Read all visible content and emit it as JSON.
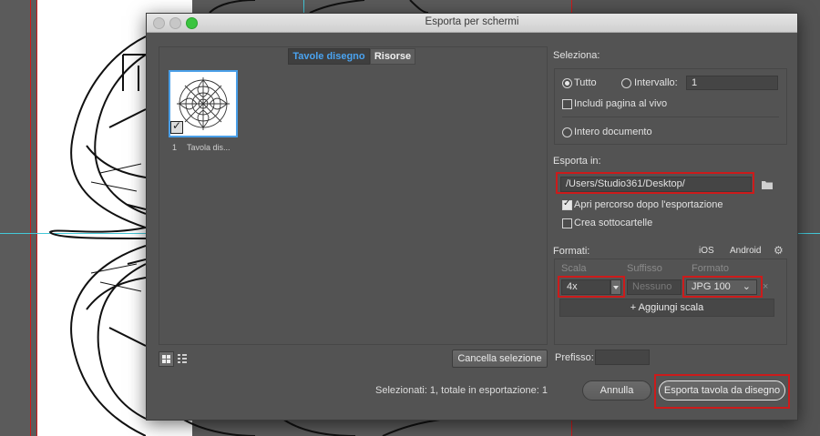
{
  "dialog": {
    "title": "Esporta per schermi",
    "tabs": [
      {
        "label": "Tavole disegno",
        "active": true
      },
      {
        "label": "Risorse",
        "active": false
      }
    ],
    "artboards": [
      {
        "number": "1",
        "label": "Tavola dis...",
        "checked": true
      }
    ],
    "clear_selection_label": "Cancella selezione",
    "prefix_label": "Prefisso:",
    "prefix_value": "",
    "summary": "Selezionati: 1, totale in esportazione: 1",
    "cancel_label": "Annulla",
    "export_label": "Esporta tavola da disegno"
  },
  "select": {
    "heading": "Seleziona:",
    "all_label": "Tutto",
    "range_label": "Intervallo:",
    "range_value": "1",
    "include_bleed_label": "Includi pagina al vivo",
    "whole_document_label": "Intero documento"
  },
  "export_to": {
    "heading": "Esporta in:",
    "path": "/Users/Studio361/Desktop/",
    "open_after_label": "Apri percorso dopo l'esportazione",
    "open_after_checked": true,
    "subfolders_label": "Crea sottocartelle",
    "subfolders_checked": false
  },
  "formats": {
    "heading": "Formati:",
    "ios_label": "iOS",
    "android_label": "Android",
    "col_scale": "Scala",
    "col_suffix": "Suffisso",
    "col_format": "Formato",
    "scale_value": "4x",
    "suffix_placeholder": "Nessuno",
    "format_value": "JPG 100",
    "add_scale_label": "+ Aggiungi scala",
    "remove_icon": "×"
  },
  "colors": {
    "accent_tab": "#4aa3f0",
    "highlight": "#cc1b1b",
    "dialog_bg": "#535353"
  }
}
